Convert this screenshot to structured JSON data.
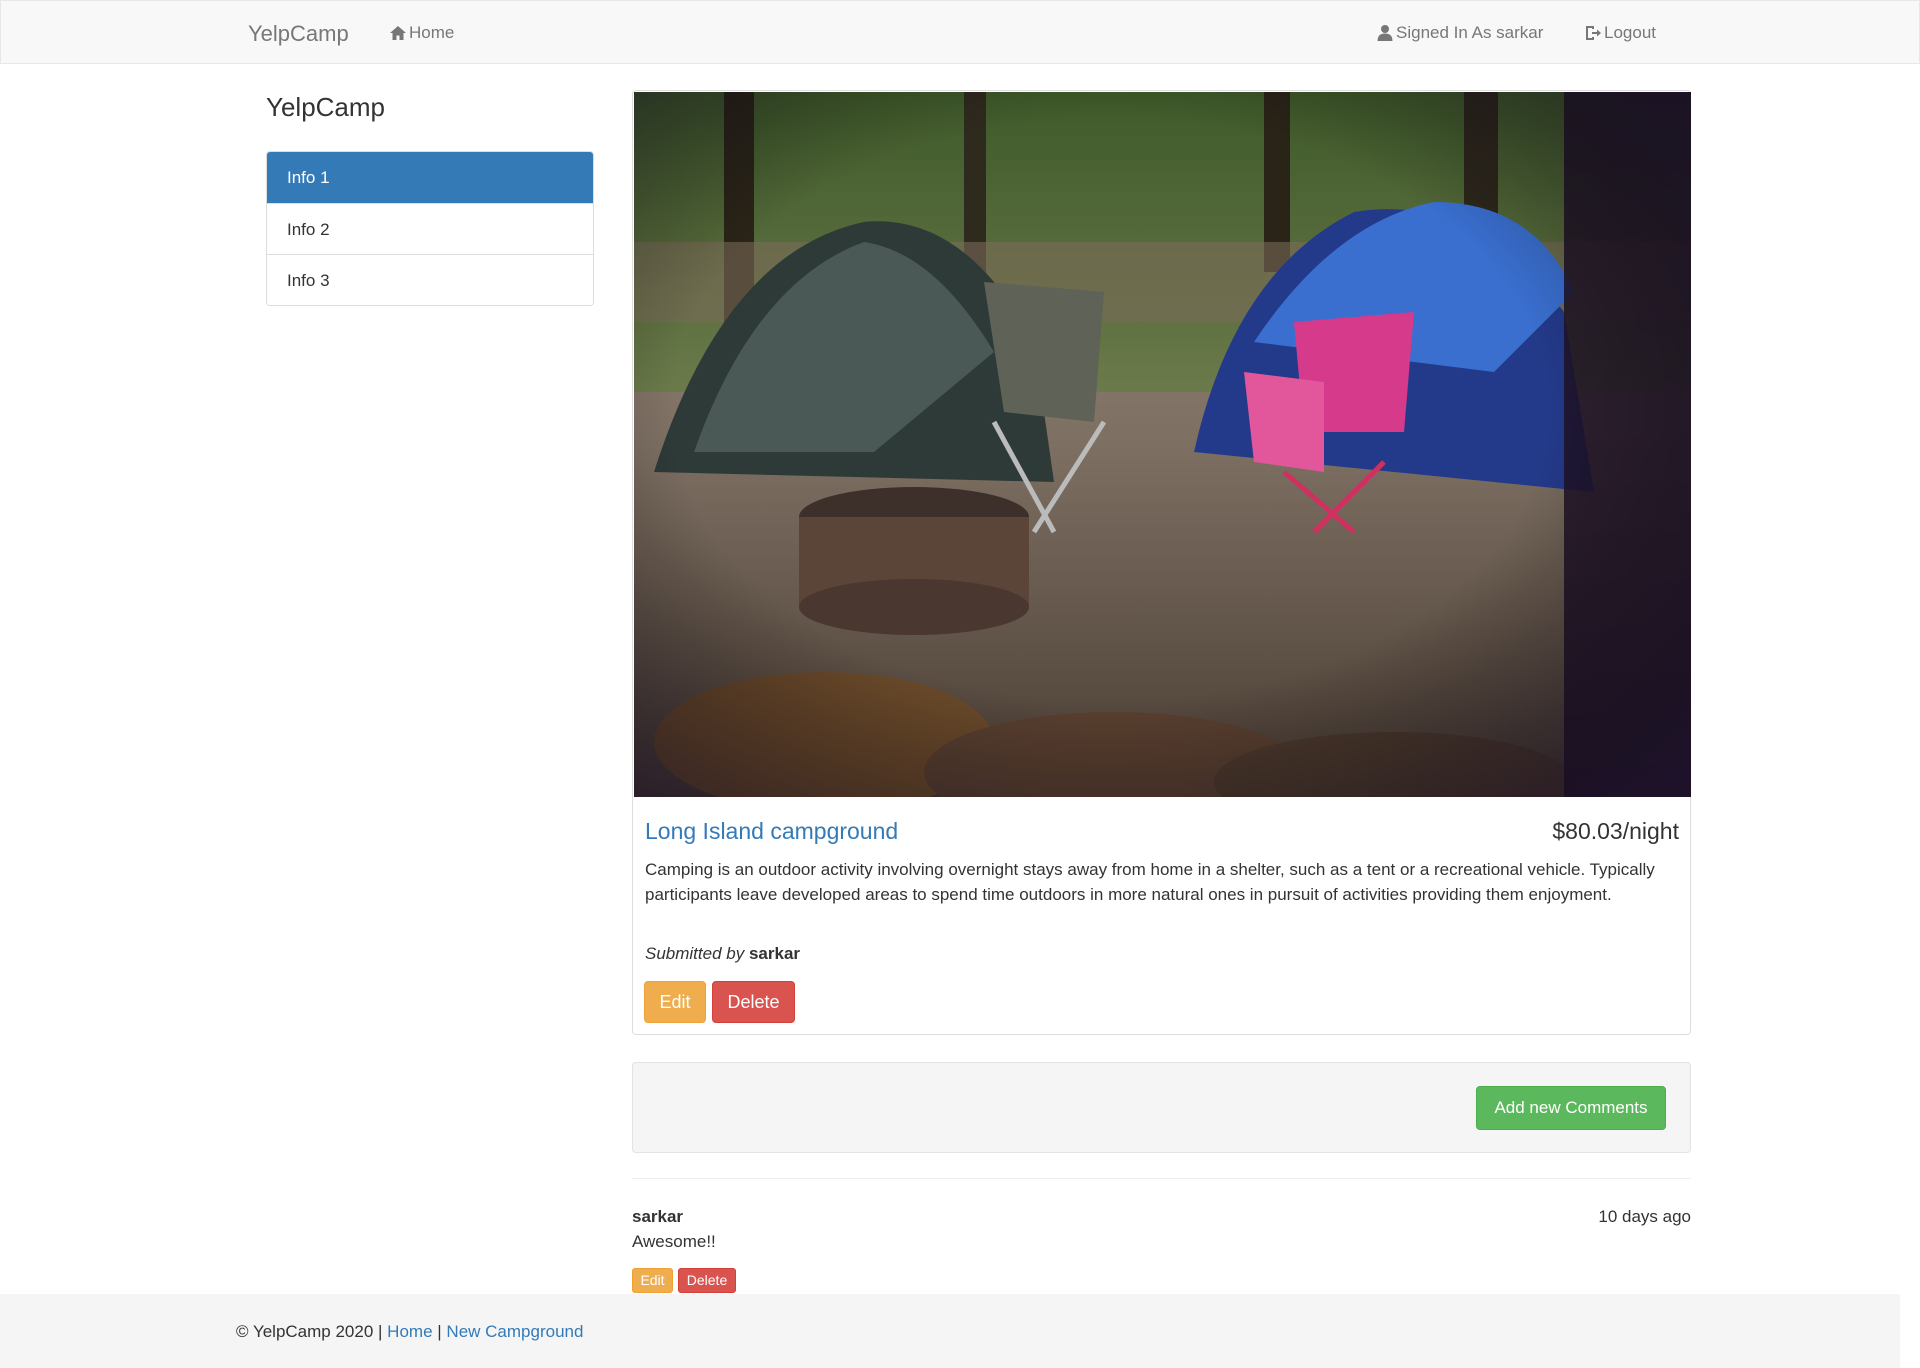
{
  "navbar": {
    "brand": "YelpCamp",
    "home": "Home",
    "signed_in": "Signed In As sarkar",
    "logout": "Logout"
  },
  "sidebar": {
    "title": "YelpCamp",
    "items": [
      {
        "label": "Info 1",
        "active": true
      },
      {
        "label": "Info 2",
        "active": false
      },
      {
        "label": "Info 3",
        "active": false
      }
    ]
  },
  "campground": {
    "name": "Long Island campground",
    "price": "$80.03/night",
    "description": "Camping is an outdoor activity involving overnight stays away from home in a shelter, such as a tent or a recreational vehicle. Typically participants leave developed areas to spend time outdoors in more natural ones in pursuit of activities providing them enjoyment.",
    "submitted_prefix": "Submitted by",
    "author": "sarkar",
    "edit_label": "Edit",
    "delete_label": "Delete"
  },
  "comments": {
    "add_label": "Add new Comments",
    "items": [
      {
        "author": "sarkar",
        "time": "10 days ago",
        "text": "Awesome!!",
        "edit_label": "Edit",
        "delete_label": "Delete"
      }
    ]
  },
  "footer": {
    "copyright": "© YelpCamp 2020 |",
    "home": "Home",
    "separator": "|",
    "new_campground": "New Campground"
  },
  "colors": {
    "primary": "#337ab7",
    "warning": "#f0ad4e",
    "danger": "#d9534f",
    "success": "#5cb85c"
  }
}
